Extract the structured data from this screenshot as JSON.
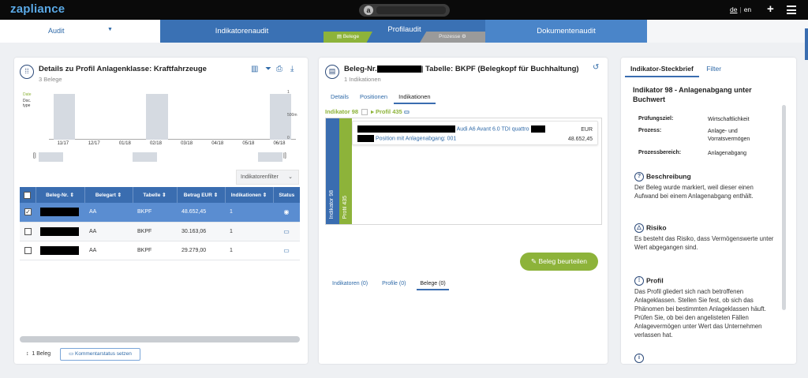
{
  "app": {
    "logo": "zapliance",
    "search_avatar_letter": "a"
  },
  "header": {
    "lang_de": "de",
    "lang_sep": "|",
    "lang_en": "en",
    "plus_label": "+"
  },
  "nav": {
    "audit_label": "Audit",
    "tabs": [
      {
        "label": "Indikatorenaudit"
      },
      {
        "label": "Profilaudit"
      },
      {
        "label": "Dokumentenaudit"
      }
    ],
    "beleg_tag": "Belege",
    "prozesse_tag": "Prozesse"
  },
  "left": {
    "title": "Details zu Profil Anlagenklasse: Kraftfahrzeuge",
    "subtitle": "3 Belege",
    "legend_date": "Date",
    "legend_doc": "Doc. type",
    "indikatorenfilter": "Indikatorenfilter",
    "footer_count": "1 Beleg",
    "footer_button": "Kommentarstatus setzen",
    "table": {
      "headers": [
        "Beleg-Nr.",
        "Belegart",
        "Tabelle",
        "Betrag EUR",
        "Indikationen",
        "Status"
      ],
      "rows": [
        {
          "belegart": "AA",
          "tabelle": "BKPF",
          "betrag": "48.652,45",
          "indikationen": "1"
        },
        {
          "belegart": "AA",
          "tabelle": "BKPF",
          "betrag": "30.163,06",
          "indikationen": "1"
        },
        {
          "belegart": "AA",
          "tabelle": "BKPF",
          "betrag": "29.279,00",
          "indikationen": "1"
        }
      ]
    }
  },
  "chart_data": {
    "type": "bar",
    "categories": [
      "11/17",
      "12/17",
      "01/18",
      "02/18",
      "03/18",
      "04/18",
      "05/18",
      "06/18"
    ],
    "values": [
      1,
      0,
      0,
      1,
      0,
      0,
      0,
      1
    ],
    "y_ticks": [
      "1",
      "500m",
      "0"
    ],
    "ylim": [
      0,
      1
    ],
    "legend": [
      "Date",
      "Doc. type"
    ]
  },
  "mid": {
    "title_prefix": "Beleg-Nr.",
    "title_suffix": "| Tabelle: BKPF (Belegkopf für Buchhaltung)",
    "subtitle": "1 Indikationen",
    "tabs": [
      "Details",
      "Positionen",
      "Indikationen"
    ],
    "crumb_indikator": "Indikator 98",
    "crumb_profil": "Profil 435",
    "vbar_indikator": "Indikator 98",
    "vbar_profil": "Profil 435",
    "card_link1": "Audi A6 Avant 6.0 TDI quattro",
    "card_link2": "Position mit Anlagenabgang: 001",
    "card_currency": "EUR",
    "card_amount": "48.652,45",
    "button_beurteilen": "Beleg beurteilen",
    "bottom_tabs": [
      "Indikatoren (0)",
      "Profile (0)",
      "Belege (0)"
    ]
  },
  "right": {
    "tabs": [
      "Indikator-Steckbrief",
      "Filter"
    ],
    "title": "Indikator 98 - Anlagenabgang unter Buchwert",
    "grid": [
      {
        "k": "Prüfungsziel:",
        "v": "Wirtschaftlichkeit"
      },
      {
        "k": "Prozess:",
        "v": "Anlage- und Vorratsvermögen"
      },
      {
        "k": "Prozessbereich:",
        "v": "Anlagenabgang"
      }
    ],
    "sections": [
      {
        "h": "Beschreibung",
        "b": "Der Beleg wurde markiert, weil dieser einen Aufwand bei einem Anlagenabgang enthält."
      },
      {
        "h": "Risiko",
        "b": "Es besteht das Risiko, dass Vermögenswerte unter Wert abgegangen sind."
      },
      {
        "h": "Profil",
        "b": "Das Profil gliedert sich nach betroffenen Anlageklassen. Stellen Sie fest, ob sich das Phänomen bei bestimmten Anlageklassen häuft. Prüfen Sie, ob bei den angelisteten Fällen Anlagevermögen unter Wert das Unternehmen verlassen hat."
      }
    ]
  }
}
